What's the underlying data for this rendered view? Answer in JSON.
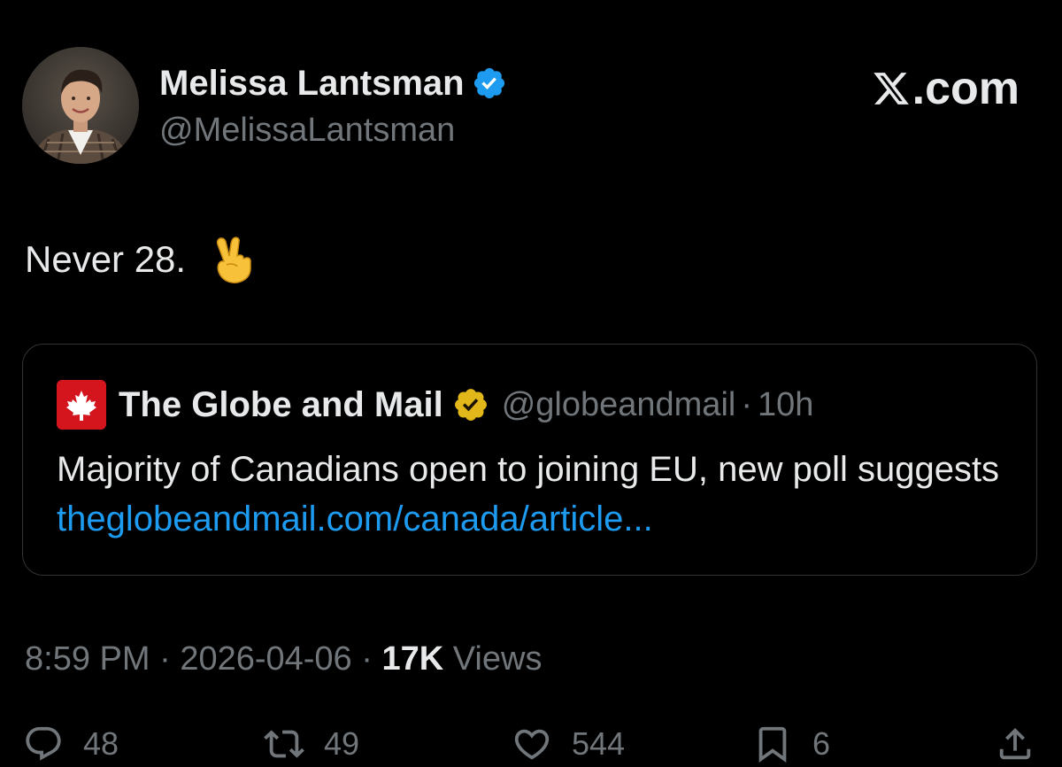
{
  "author": {
    "name": "Melissa Lantsman",
    "handle": "@MelissaLantsman"
  },
  "brand": {
    "label": ".com"
  },
  "tweet": {
    "text": "Never 28.",
    "emoji": "victory-hand"
  },
  "quote": {
    "name": "The Globe and Mail",
    "handle": "@globeandmail",
    "separator": "·",
    "time": "10h",
    "text": "Majority of Canadians open to joining EU, new poll suggests",
    "link": "theglobeandmail.com/canada/article..."
  },
  "meta": {
    "time": "8:59 PM",
    "sep1": "·",
    "date": "2026-04-06",
    "sep2": "·",
    "views_count": "17K",
    "views_label": "Views"
  },
  "actions": {
    "replies": "48",
    "reposts": "49",
    "likes": "544",
    "bookmarks": "6"
  },
  "icons": {
    "verified": "verified-badge-icon",
    "reply": "reply-icon",
    "repost": "repost-icon",
    "like": "heart-icon",
    "bookmark": "bookmark-icon",
    "share": "share-icon"
  },
  "colors": {
    "background": "#000000",
    "text": "#e7e9ea",
    "muted": "#71767b",
    "link": "#1d9bf0",
    "verified_blue": "#1d9bf0",
    "verified_gold": "#e2b719",
    "globe_red": "#d4151e",
    "border": "#2f3336"
  }
}
